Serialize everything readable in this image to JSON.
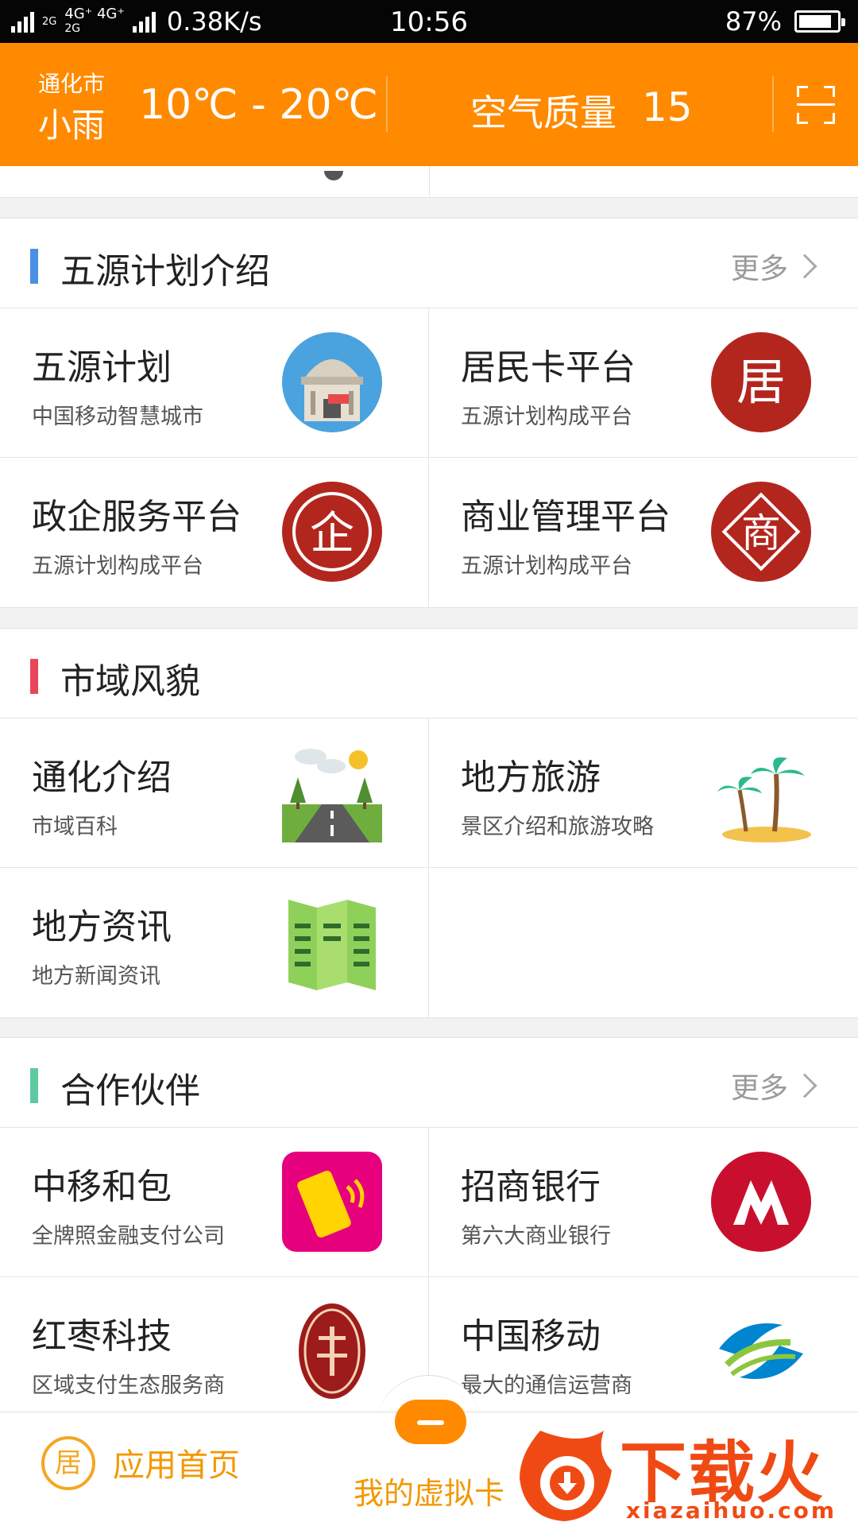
{
  "status_bar": {
    "network_top": "2G",
    "network_mid": "4G⁺ 4G⁺",
    "network_low": "2G",
    "speed": "0.38K/s",
    "time": "10:56",
    "battery": "87%",
    "battery_level": 0.87
  },
  "header": {
    "city": "通化市",
    "weather": "小雨",
    "temperature": "10℃ - 20℃",
    "aqi_label": "空气质量",
    "aqi_value": "15",
    "scan_icon": "scan-icon"
  },
  "sections": {
    "plan": {
      "title": "五源计划介绍",
      "accent": "#4a90e2",
      "more": "更多",
      "items": [
        {
          "title": "五源计划",
          "subtitle": "中国移动智慧城市"
        },
        {
          "title": "居民卡平台",
          "subtitle": "五源计划构成平台",
          "glyph": "居"
        },
        {
          "title": "政企服务平台",
          "subtitle": "五源计划构成平台",
          "glyph": "企"
        },
        {
          "title": "商业管理平台",
          "subtitle": "五源计划构成平台",
          "glyph": "商"
        }
      ]
    },
    "city": {
      "title": "市域风貌",
      "accent": "#e8455a",
      "items": [
        {
          "title": "通化介绍",
          "subtitle": "市域百科"
        },
        {
          "title": "地方旅游",
          "subtitle": "景区介绍和旅游攻略"
        },
        {
          "title": "地方资讯",
          "subtitle": "地方新闻资讯"
        }
      ]
    },
    "partners": {
      "title": "合作伙伴",
      "accent": "#5ec8a0",
      "more": "更多",
      "items": [
        {
          "title": "中移和包",
          "subtitle": "全牌照金融支付公司"
        },
        {
          "title": "招商银行",
          "subtitle": "第六大商业银行"
        },
        {
          "title": "红枣科技",
          "subtitle": "区域支付生态服务商"
        },
        {
          "title": "中国移动",
          "subtitle": "最大的通信运营商"
        }
      ]
    }
  },
  "bottom_nav": {
    "home_label": "应用首页",
    "home_glyph": "居",
    "vcard_label": "我的虚拟卡"
  },
  "watermark": {
    "brand": "下载火",
    "url": "xiazaihuo.com"
  }
}
